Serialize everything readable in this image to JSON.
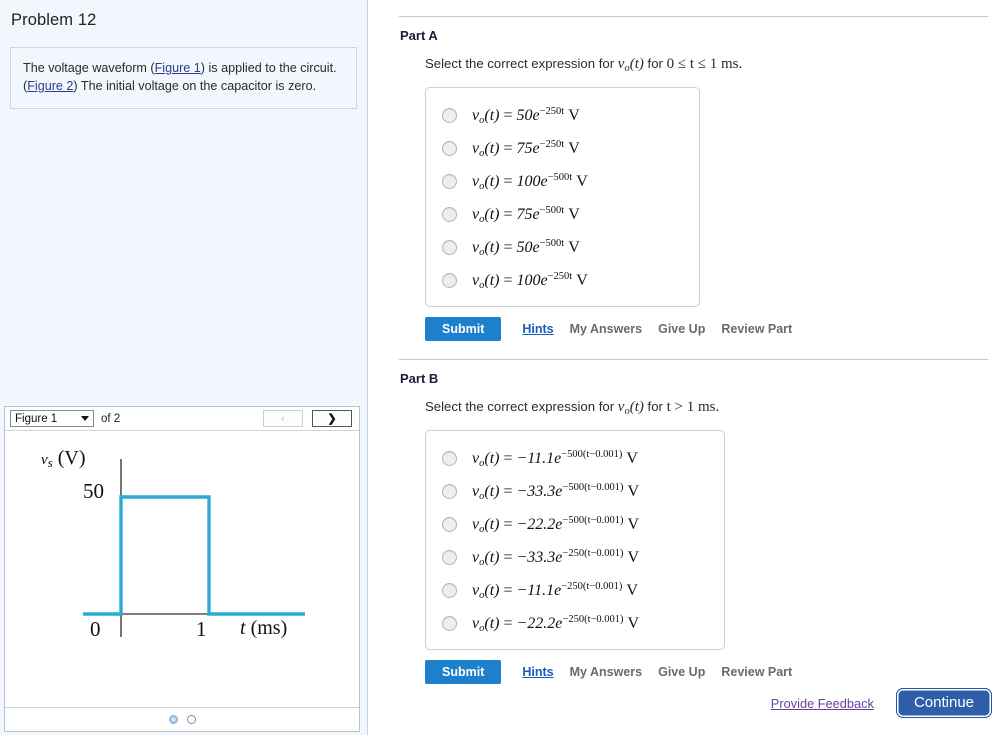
{
  "problem": {
    "title": "Problem 12",
    "statement_line1_pre": "The voltage waveform (",
    "statement_link1": "Figure 1",
    "statement_line1_post": ") is applied to the circuit.",
    "statement_link2": "Figure 2",
    "statement_line2_post": ") The initial voltage on the capacitor is zero."
  },
  "figure_viewer": {
    "selected_figure": "Figure 1",
    "count_label": "of 2",
    "prev_label": "‹",
    "next_label": "❯",
    "pager_dots": 2,
    "active_dot": 1
  },
  "chart_data": {
    "type": "line",
    "title": "",
    "xlabel": "t (ms)",
    "ylabel": "v_s (V)",
    "y_tick_labels": [
      "50"
    ],
    "x_tick_labels": [
      "0",
      "1"
    ],
    "xlim": [
      -0.35,
      2.1
    ],
    "ylim": [
      0,
      62
    ],
    "grid": false,
    "legend": "none",
    "series": [
      {
        "name": "vs(t)",
        "color": "#29abd6",
        "x": [
          -0.35,
          0,
          0,
          1,
          1,
          2.05
        ],
        "y": [
          0,
          0,
          50,
          50,
          0,
          0
        ]
      }
    ],
    "annotations": [
      "rectangular pulse of 50 V from t = 0 to t = 1 ms"
    ]
  },
  "parts": [
    {
      "heading": "Part A",
      "prompt_pre": "Select the correct expression for ",
      "prompt_var": "v",
      "prompt_sub": "o",
      "prompt_arg": "(t)",
      "prompt_mid": " for ",
      "prompt_range": "0 ≤ t ≤ 1",
      "prompt_unit": " ms.",
      "options": [
        {
          "lhs": "v",
          "sub": "o",
          "arg": "(t)",
          "eq": " = ",
          "coef": "50e",
          "exp": "−250t",
          "unit": "V"
        },
        {
          "lhs": "v",
          "sub": "o",
          "arg": "(t)",
          "eq": " = ",
          "coef": "75e",
          "exp": "−250t",
          "unit": "V"
        },
        {
          "lhs": "v",
          "sub": "o",
          "arg": "(t)",
          "eq": " = ",
          "coef": "100e",
          "exp": "−500t",
          "unit": "V"
        },
        {
          "lhs": "v",
          "sub": "o",
          "arg": "(t)",
          "eq": " = ",
          "coef": "75e",
          "exp": "−500t",
          "unit": "V"
        },
        {
          "lhs": "v",
          "sub": "o",
          "arg": "(t)",
          "eq": " = ",
          "coef": "50e",
          "exp": "−500t",
          "unit": "V"
        },
        {
          "lhs": "v",
          "sub": "o",
          "arg": "(t)",
          "eq": " = ",
          "coef": "100e",
          "exp": "−250t",
          "unit": "V"
        }
      ],
      "actions": {
        "submit": "Submit",
        "hints": "Hints",
        "my_answers": "My Answers",
        "give_up": "Give Up",
        "review_part": "Review Part"
      }
    },
    {
      "heading": "Part B",
      "prompt_pre": "Select the correct expression for ",
      "prompt_var": "v",
      "prompt_sub": "o",
      "prompt_arg": "(t)",
      "prompt_mid": " for ",
      "prompt_range": "t > 1",
      "prompt_unit": " ms.",
      "options": [
        {
          "lhs": "v",
          "sub": "o",
          "arg": "(t)",
          "eq": " = ",
          "coef": "−11.1e",
          "exp": "−500(t−0.001)",
          "unit": "V"
        },
        {
          "lhs": "v",
          "sub": "o",
          "arg": "(t)",
          "eq": " = ",
          "coef": "−33.3e",
          "exp": "−500(t−0.001)",
          "unit": "V"
        },
        {
          "lhs": "v",
          "sub": "o",
          "arg": "(t)",
          "eq": " = ",
          "coef": "−22.2e",
          "exp": "−500(t−0.001)",
          "unit": "V"
        },
        {
          "lhs": "v",
          "sub": "o",
          "arg": "(t)",
          "eq": " = ",
          "coef": "−33.3e",
          "exp": "−250(t−0.001)",
          "unit": "V"
        },
        {
          "lhs": "v",
          "sub": "o",
          "arg": "(t)",
          "eq": " = ",
          "coef": "−11.1e",
          "exp": "−250(t−0.001)",
          "unit": "V"
        },
        {
          "lhs": "v",
          "sub": "o",
          "arg": "(t)",
          "eq": " = ",
          "coef": "−22.2e",
          "exp": "−250(t−0.001)",
          "unit": "V"
        }
      ],
      "actions": {
        "submit": "Submit",
        "hints": "Hints",
        "my_answers": "My Answers",
        "give_up": "Give Up",
        "review_part": "Review Part"
      }
    }
  ],
  "footer": {
    "feedback_label": "Provide Feedback",
    "continue_label": "Continue"
  },
  "colors": {
    "submit_blue": "#1d80cd",
    "continue_blue": "#2f5fa8",
    "waveform": "#29abd6",
    "left_panel_bg": "#f2f6fd",
    "link": "#2a3f8f",
    "visited_link": "#6a3fa0"
  }
}
